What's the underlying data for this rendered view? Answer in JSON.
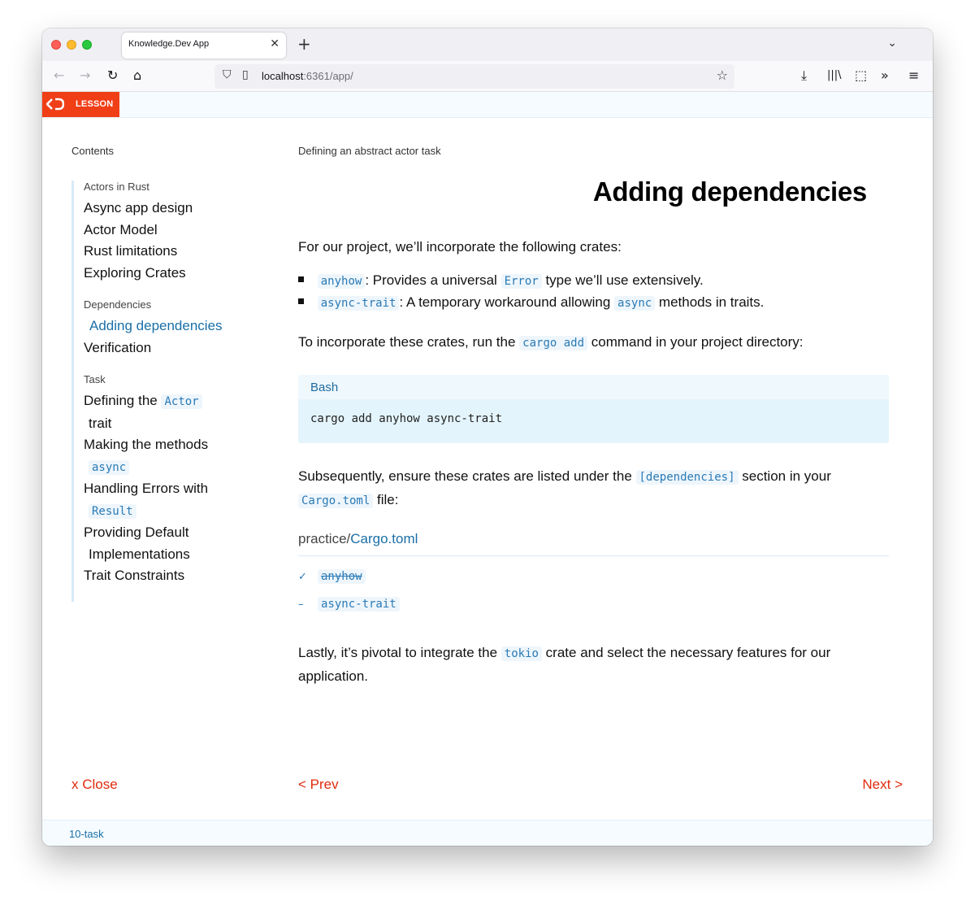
{
  "browser": {
    "tab_title": "Knowledge.Dev App",
    "url_host": "localhost",
    "url_path": ":6361/app/"
  },
  "header": {
    "badge_label": "LESSON",
    "brand_color": "#f03e17"
  },
  "sidebar": {
    "contents_label": "Contents",
    "groups": [
      {
        "title": "Actors in Rust",
        "items": [
          "Async app design",
          "Actor Model",
          "Rust limitations",
          "Exploring Crates"
        ]
      },
      {
        "title": "Dependencies",
        "items": [
          "Adding dependencies",
          "Verification"
        ],
        "active_item": "Adding dependencies"
      },
      {
        "title": "Task",
        "items": [
          {
            "text": "Defining the",
            "code": "Actor",
            "tail": "trait"
          },
          {
            "text": "Making the methods",
            "code": "async"
          },
          {
            "text": "Handling Errors with",
            "code": "Result"
          },
          {
            "text": "Providing Default",
            "tail": "Implementations"
          },
          {
            "text": "Trait Constraints"
          }
        ]
      }
    ]
  },
  "main": {
    "breadcrumb": "Defining an abstract actor task",
    "title": "Adding dependencies",
    "intro": "For our project, we’ll incorporate the following crates:",
    "bullets": [
      {
        "code": "anyhow",
        "text_before": ": Provides a universal ",
        "code2": "Error",
        "text_after": " type we’ll use extensively."
      },
      {
        "code": "async-trait",
        "text_before": ": A temporary workaround allowing ",
        "code2": "async",
        "text_after": " methods in traits."
      }
    ],
    "run_text_before": "To incorporate these crates, run the ",
    "run_code": "cargo add",
    "run_text_after": " command in your project directory:",
    "codeblock": {
      "language": "Bash",
      "code": "cargo add anyhow async-trait"
    },
    "subsequently_before": "Subsequently, ensure these crates are listed under the ",
    "subsequently_code": "[dependencies]",
    "subsequently_after": " section in your",
    "cargo_code": "Cargo.toml",
    "cargo_after": " file:",
    "file_prefix": "practice/",
    "file_name": "Cargo.toml",
    "deps": [
      {
        "mark": "✓",
        "name": "anyhow",
        "done": true
      },
      {
        "mark": "–",
        "name": "async-trait",
        "done": false
      }
    ],
    "lastly_before": "Lastly, it’s pivotal to integrate the ",
    "lastly_code": "tokio",
    "lastly_after": " crate and select the necessary features for our",
    "lastly_line2": "application."
  },
  "footer": {
    "close_label": "x Close",
    "prev_label": "< Prev",
    "next_label": "Next >",
    "status": "10-task"
  }
}
